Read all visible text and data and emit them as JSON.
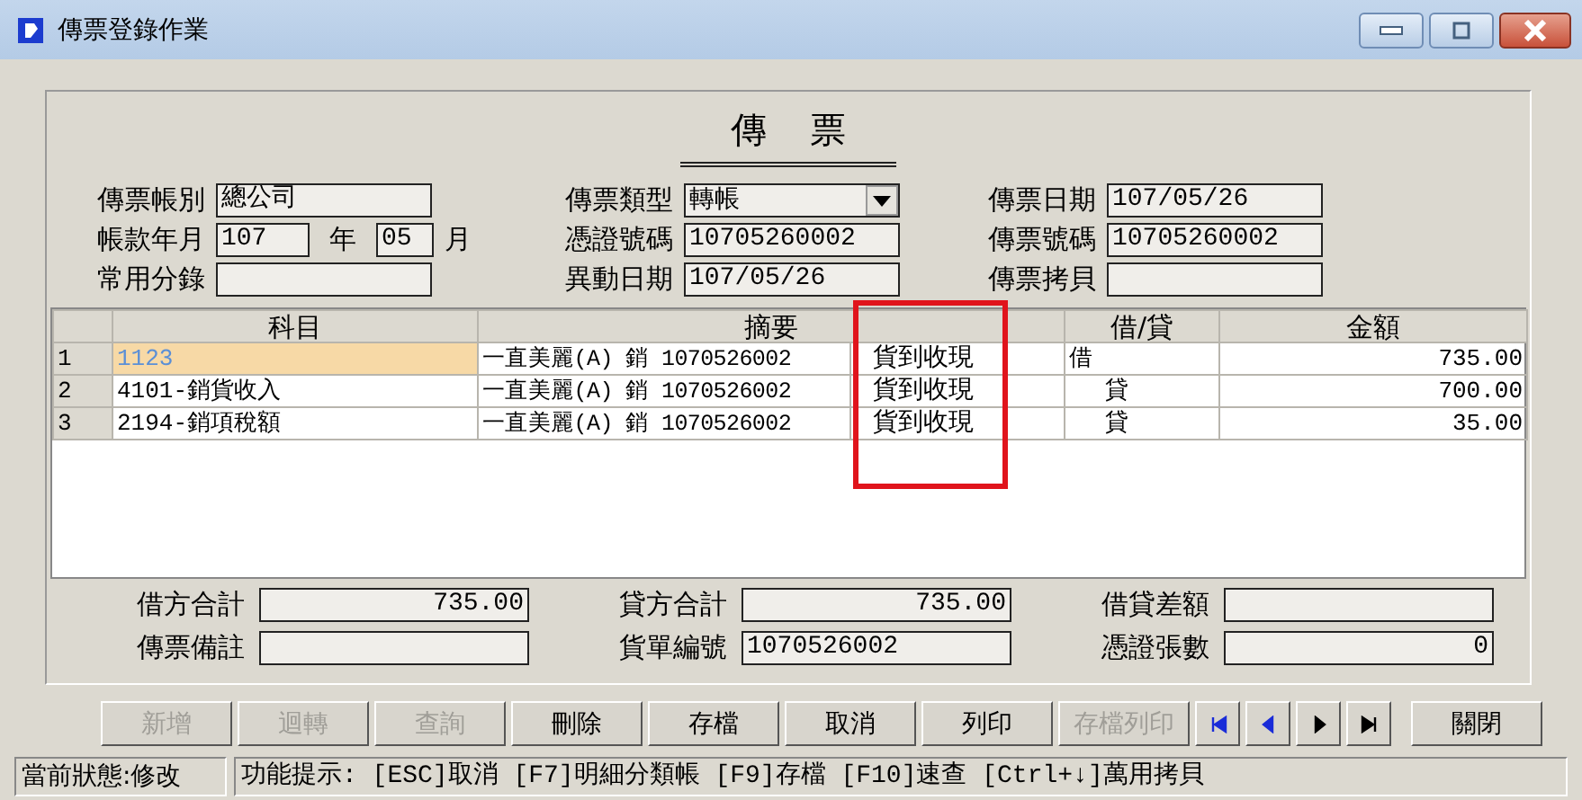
{
  "window": {
    "title": "傳票登錄作業"
  },
  "form_title": "傳 票",
  "header_fields": [
    {
      "label": "傳票帳別",
      "kind": "text",
      "value": "總公司"
    },
    {
      "label": "傳票類型",
      "kind": "select",
      "value": "轉帳"
    },
    {
      "label": "傳票日期",
      "kind": "text",
      "value": "107/05/26"
    },
    {
      "label": "帳款年月",
      "kind": "yearmonth",
      "year": "107",
      "year_unit": "年",
      "month": "05",
      "month_unit": "月"
    },
    {
      "label": "憑證號碼",
      "kind": "text",
      "value": "10705260002"
    },
    {
      "label": "傳票號碼",
      "kind": "text",
      "value": "10705260002"
    },
    {
      "label": "常用分錄",
      "kind": "text"
    },
    {
      "label": "異動日期",
      "kind": "text",
      "value": "107/05/26"
    },
    {
      "label": "傳票拷貝",
      "kind": "text"
    }
  ],
  "grid": {
    "columns": [
      "科目",
      "摘要",
      "借/貸",
      "金額"
    ],
    "rows": [
      {
        "number": "1",
        "account": "1123",
        "summary": "一直美麗(A) 銷 1070526002",
        "note": "貨到收現",
        "side": "借",
        "kind": "debit",
        "amount": "735.00",
        "selected": true
      },
      {
        "number": "2",
        "account": "4101-銷貨收入",
        "summary": "一直美麗(A) 銷 1070526002",
        "note": "貨到收現",
        "side": "貸",
        "kind": "credit",
        "amount": "700.00",
        "selected": false
      },
      {
        "number": "3",
        "account": "2194-銷項稅額",
        "summary": "一直美麗(A) 銷 1070526002",
        "note": "貨到收現",
        "side": "貸",
        "kind": "credit",
        "amount": "35.00",
        "selected": false
      }
    ]
  },
  "totals": [
    {
      "label": "借方合計",
      "kind": "amount",
      "value": "735.00"
    },
    {
      "label": "貸方合計",
      "kind": "amount",
      "value": "735.00"
    },
    {
      "label": "借貸差額",
      "kind": "amount"
    },
    {
      "label": "傳票備註",
      "kind": "text"
    },
    {
      "label": "貨單編號",
      "kind": "text",
      "value": "1070526002"
    },
    {
      "label": "憑證張數",
      "kind": "amount",
      "value": "0"
    }
  ],
  "buttons": [
    {
      "label": "新增",
      "disabled": true
    },
    {
      "label": "迴轉",
      "disabled": true
    },
    {
      "label": "查詢",
      "disabled": true
    },
    {
      "label": "刪除",
      "disabled": false
    },
    {
      "label": "存檔",
      "disabled": false
    },
    {
      "label": "取消",
      "disabled": false
    },
    {
      "label": "列印",
      "disabled": false
    },
    {
      "label": "存檔列印",
      "disabled": true
    }
  ],
  "nav_buttons": [
    {
      "kind": "first"
    },
    {
      "kind": "previous"
    },
    {
      "kind": "next"
    },
    {
      "kind": "last"
    }
  ],
  "close_button": {
    "label": "關閉"
  },
  "status_bar": {
    "state": "當前狀態:修改",
    "hint": "功能提示: [ESC]取消 [F7]明細分類帳 [F9]存檔 [F10]速查 [Ctrl+↓]萬用拷貝"
  }
}
